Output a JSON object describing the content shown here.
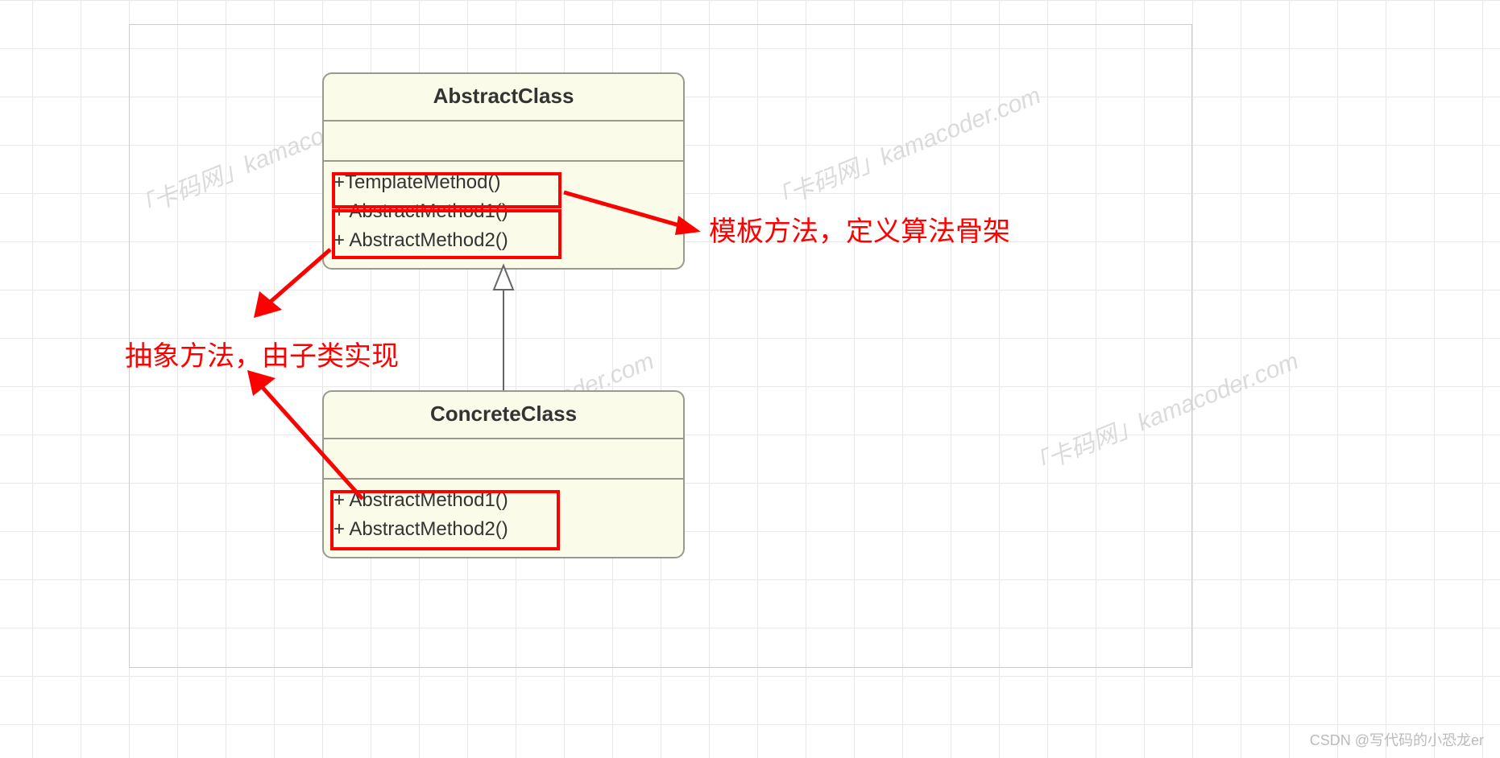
{
  "diagram": {
    "abstract_class": {
      "name": "AbstractClass",
      "methods": [
        "+TemplateMethod()",
        "+ AbstractMethod1()",
        "+ AbstractMethod2()"
      ]
    },
    "concrete_class": {
      "name": "ConcreteClass",
      "methods": [
        "+ AbstractMethod1()",
        "+ AbstractMethod2()"
      ]
    }
  },
  "annotations": {
    "template_method": "模板方法，定义算法骨架",
    "abstract_method": "抽象方法，由子类实现"
  },
  "watermark": "「卡码网」kamacoder.com",
  "attribution": "CSDN @写代码的小恐龙er"
}
